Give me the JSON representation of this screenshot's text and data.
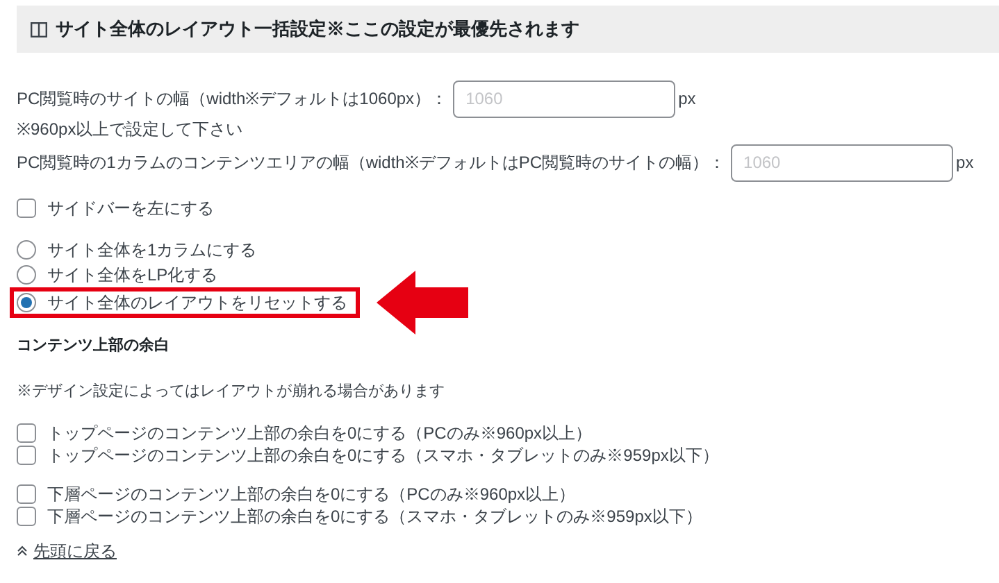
{
  "section_title": "サイト全体のレイアウト一括設定※ここの設定が最優先されます",
  "width_fields": [
    {
      "label": "PC閲覧時のサイトの幅（width※デフォルトは1060px）：",
      "placeholder": "1060",
      "unit": "px",
      "note": "※960px以上で設定して下さい"
    },
    {
      "label": "PC閲覧時の1カラムのコンテンツエリアの幅（width※デフォルトはPC閲覧時のサイトの幅）：",
      "placeholder": "1060",
      "unit": "px"
    }
  ],
  "sidebar_option": {
    "label": "サイドバーを左にする",
    "checked": false
  },
  "layout_options": [
    {
      "label": "サイト全体を1カラムにする",
      "selected": false,
      "highlighted": false
    },
    {
      "label": "サイト全体をLP化する",
      "selected": false,
      "highlighted": false
    },
    {
      "label": "サイト全体のレイアウトをリセットする",
      "selected": true,
      "highlighted": true
    }
  ],
  "margin_heading": "コンテンツ上部の余白",
  "margin_note": "※デザイン設定によってはレイアウトが崩れる場合があります",
  "margin_groups": [
    [
      {
        "label": "トップページのコンテンツ上部の余白を0にする（PCのみ※960px以上）",
        "checked": false
      },
      {
        "label": "トップページのコンテンツ上部の余白を0にする（スマホ・タブレットのみ※959px以下）",
        "checked": false
      }
    ],
    [
      {
        "label": "下層ページのコンテンツ上部の余白を0にする（PCのみ※960px以上）",
        "checked": false
      },
      {
        "label": "下層ページのコンテンツ上部の余白を0にする（スマホ・タブレットのみ※959px以下）",
        "checked": false
      }
    ]
  ],
  "back_link": "先頭に戻る"
}
